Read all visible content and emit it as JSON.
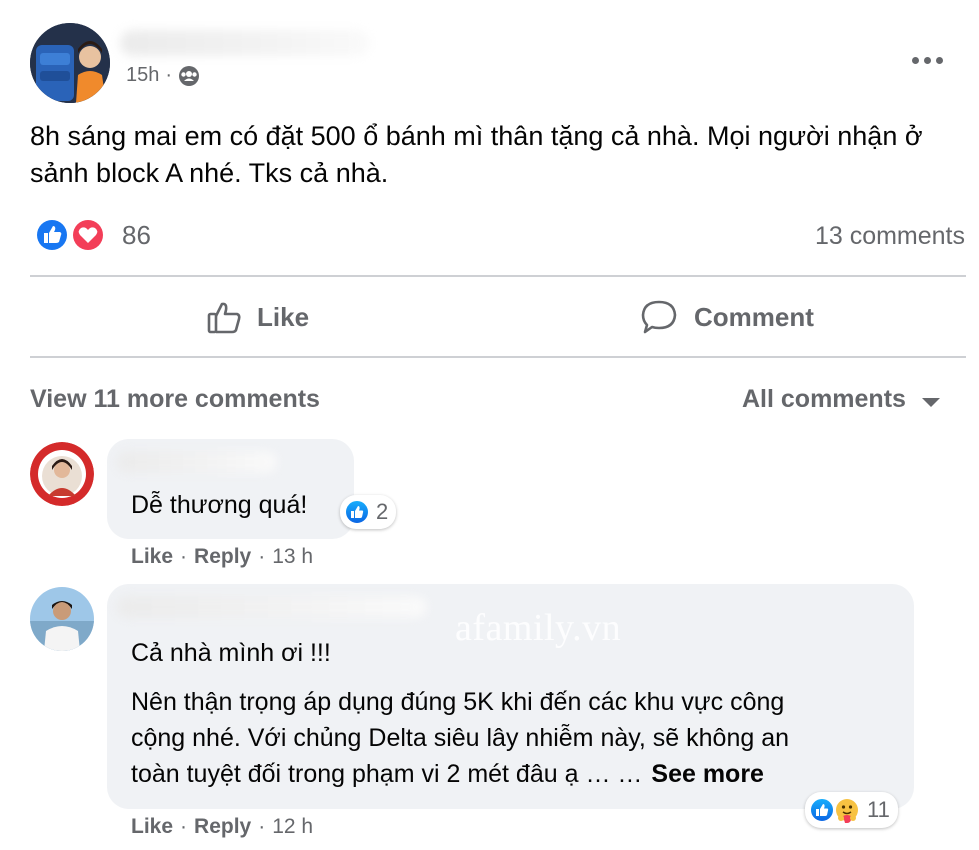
{
  "post": {
    "time": "15h",
    "separator": "·",
    "text": "8h sáng mai em có đặt 500 ổ bánh mì thân tặng cả nhà. Mọi người nhận ở sảnh block A nhé. Tks cả nhà.",
    "reaction_count": "86",
    "comment_count_label": "13 comments",
    "like_label": "Like",
    "comment_label": "Comment",
    "more_icon": "more-options-icon",
    "audience_icon": "group-icon"
  },
  "comments_bar": {
    "view_more": "View 11 more comments",
    "sort_label": "All comments"
  },
  "comments": [
    {
      "text": "Dễ thương quá!",
      "reaction_count": "2",
      "like": "Like",
      "dot": "·",
      "reply": "Reply",
      "time": "13 h"
    },
    {
      "line1": "Cả nhà mình ơi !!!",
      "line2": "Nên thận trọng áp dụng đúng 5K khi đến các khu vực công",
      "line3": "cộng nhé. Với chủng Delta siêu lây nhiễm này, sẽ không an",
      "line4": "toàn tuyệt đối trong phạm vi 2 mét đâu ạ … …",
      "see_more": "See more",
      "reaction_count": "11",
      "like": "Like",
      "dot": "·",
      "reply": "Reply",
      "time": "12 h"
    }
  ],
  "watermark": "afamily.vn",
  "colors": {
    "like_blue": "#1877f2",
    "love_red": "#f33e58",
    "bubble": "#f0f2f5",
    "secondary_text": "#65676b"
  }
}
